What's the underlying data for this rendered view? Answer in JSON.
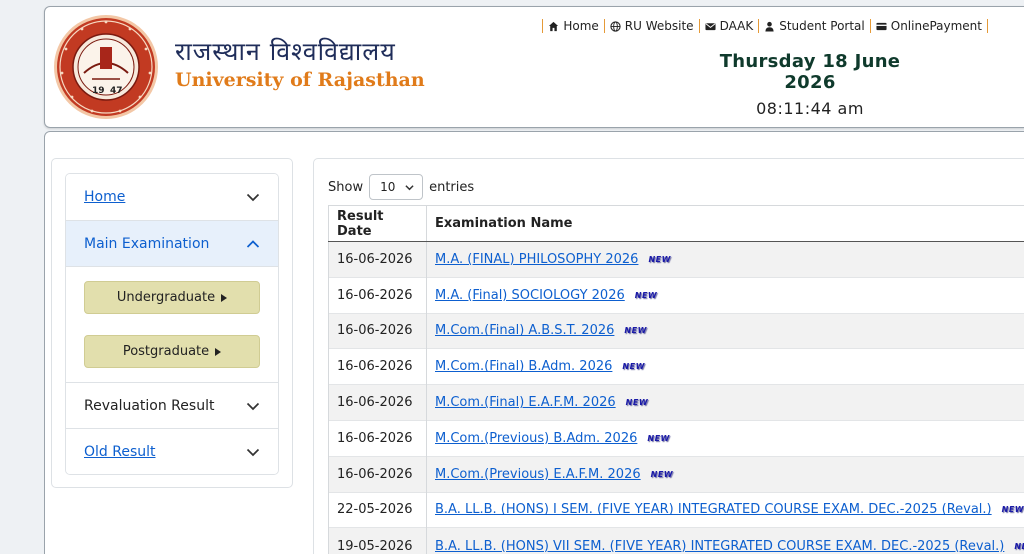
{
  "header": {
    "brand_hindi": "राजस्थान विश्वविद्यालय",
    "brand_english": "University of Rajasthan",
    "date": "Thursday 18 June 2026",
    "time": "08:11:44 am",
    "nav": [
      {
        "label": "Home",
        "icon": "home-icon"
      },
      {
        "label": "RU Website",
        "icon": "globe-icon"
      },
      {
        "label": "DAAK",
        "icon": "envelope-icon"
      },
      {
        "label": "Student Portal",
        "icon": "user-icon"
      },
      {
        "label": "OnlinePayment",
        "icon": "card-icon"
      }
    ]
  },
  "sidebar": {
    "items": [
      {
        "label": "Home"
      },
      {
        "label": "Main Examination"
      },
      {
        "label": "Revaluation Result"
      },
      {
        "label": "Old Result"
      }
    ],
    "sub_items": [
      {
        "label": "Undergraduate"
      },
      {
        "label": "Postgraduate"
      }
    ]
  },
  "table": {
    "show_label": "Show",
    "entries_label": "entries",
    "page_length": "10",
    "columns": [
      "Result Date",
      "Examination Name"
    ],
    "new_label": "NEW",
    "rows": [
      {
        "date": "16-06-2026",
        "name": "M.A. (FINAL) PHILOSOPHY 2026"
      },
      {
        "date": "16-06-2026",
        "name": "M.A. (Final) SOCIOLOGY 2026"
      },
      {
        "date": "16-06-2026",
        "name": "M.Com.(Final) A.B.S.T. 2026"
      },
      {
        "date": "16-06-2026",
        "name": "M.Com.(Final) B.Adm. 2026"
      },
      {
        "date": "16-06-2026",
        "name": "M.Com.(Final) E.A.F.M. 2026"
      },
      {
        "date": "16-06-2026",
        "name": "M.Com.(Previous) B.Adm. 2026"
      },
      {
        "date": "16-06-2026",
        "name": "M.Com.(Previous) E.A.F.M. 2026"
      },
      {
        "date": "22-05-2026",
        "name": "B.A. LL.B. (HONS) I SEM. (FIVE YEAR) INTEGRATED COURSE EXAM. DEC.-2025 (Reval.)"
      },
      {
        "date": "19-05-2026",
        "name": "B.A. LL.B. (HONS) VII SEM. (FIVE YEAR) INTEGRATED COURSE EXAM. DEC.-2025 (Reval.)"
      }
    ]
  },
  "seal": {
    "year_left": "19",
    "year_right": "47"
  },
  "colors": {
    "brand_navy": "#1f2d5a",
    "brand_orange": "#e07b1a",
    "link": "#0d5fcf",
    "sub_button": "#e2dfad",
    "seal_red": "#b8321f"
  }
}
